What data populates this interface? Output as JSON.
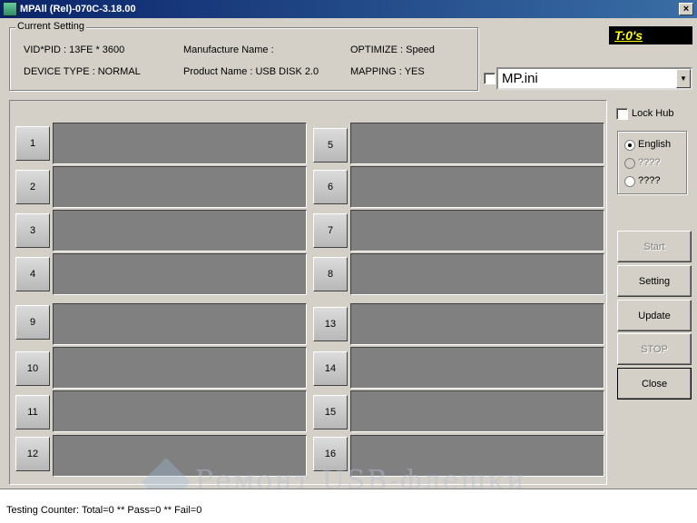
{
  "window": {
    "title": "MPAll (Rel)-070C-3.18.00",
    "close_glyph": "×"
  },
  "current_setting": {
    "label": "Current Setting",
    "vid_pid": "VID*PID : 13FE * 3600",
    "device_type": "DEVICE TYPE : NORMAL",
    "manufacture_name": "Manufacture Name :",
    "product_name": "Product Name : USB DISK 2.0",
    "optimize": "OPTIMIZE : Speed",
    "mapping": "MAPPING : YES"
  },
  "timer": "T:0's",
  "ini_select": {
    "value": "MP.ini",
    "checked": false
  },
  "ports": [
    "1",
    "2",
    "3",
    "4",
    "5",
    "6",
    "7",
    "8",
    "9",
    "10",
    "11",
    "12",
    "13",
    "14",
    "15",
    "16"
  ],
  "lock_hub": {
    "label": "Lock Hub",
    "checked": false
  },
  "language": {
    "options": [
      {
        "label": "English",
        "checked": true,
        "disabled": false
      },
      {
        "label": "????",
        "checked": false,
        "disabled": true
      },
      {
        "label": "????",
        "checked": false,
        "disabled": false
      }
    ]
  },
  "buttons": {
    "start": "Start",
    "setting": "Setting",
    "update": "Update",
    "stop": "STOP",
    "close": "Close"
  },
  "watermark": "Ремонт USB-флешки",
  "status": "Testing Counter: Total=0 ** Pass=0 ** Fail=0"
}
